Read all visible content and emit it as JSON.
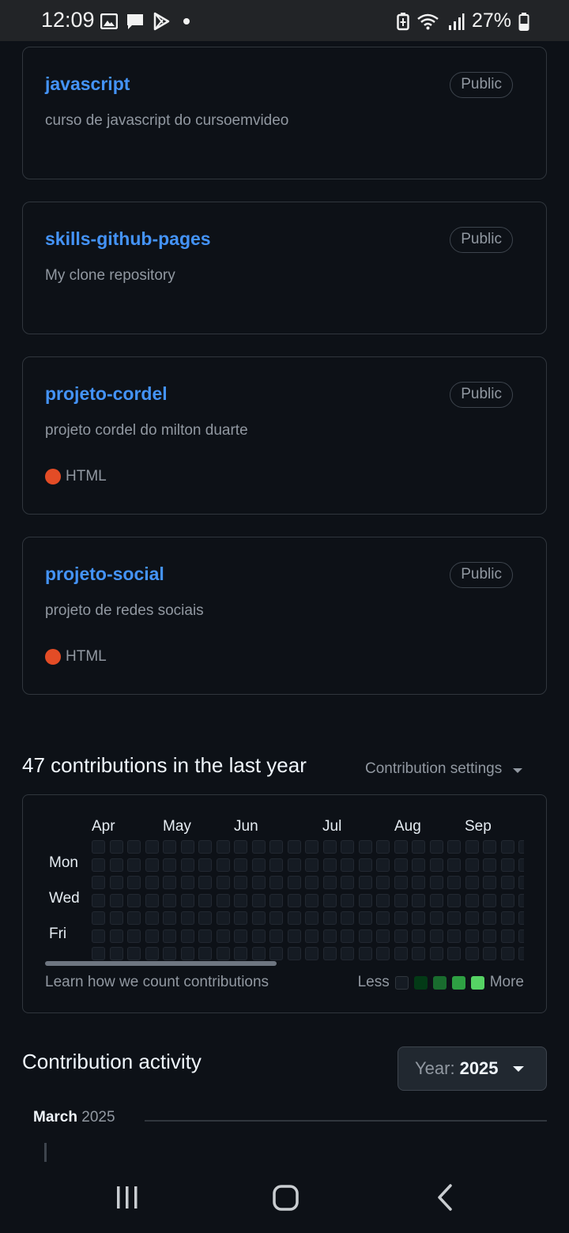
{
  "status_bar": {
    "time": "12:09",
    "battery": "27%",
    "left_icons": [
      "image-icon",
      "message-icon",
      "play-store-icon",
      "dot-icon"
    ],
    "right_icons": [
      "battery-saver-icon",
      "wifi-icon",
      "signal-icon",
      "battery-icon"
    ]
  },
  "repos": [
    {
      "name": "javascript",
      "description": "curso de javascript do cursoemvideo",
      "visibility": "Public",
      "language": ""
    },
    {
      "name": "skills-github-pages",
      "description": "My clone repository",
      "visibility": "Public",
      "language": ""
    },
    {
      "name": "projeto-cordel",
      "description": "projeto cordel do milton duarte",
      "visibility": "Public",
      "language": "HTML"
    },
    {
      "name": "projeto-social",
      "description": "projeto de redes sociais",
      "visibility": "Public",
      "language": "HTML"
    }
  ],
  "colors": {
    "html_language": "#e34c26",
    "link": "#4493f8",
    "legend_levels": [
      "#151b23",
      "#033a16",
      "#196c2e",
      "#2ea043",
      "#56d364"
    ]
  },
  "contributions": {
    "title": "47 contributions in the last year",
    "settings_label": "Contribution settings",
    "months": [
      "Apr",
      "May",
      "Jun",
      "Jul",
      "Aug",
      "Sep"
    ],
    "days": [
      "Mon",
      "Wed",
      "Fri"
    ],
    "learn_link": "Learn how we count contributions",
    "legend_less": "Less",
    "legend_more": "More"
  },
  "activity": {
    "title": "Contribution activity",
    "year_label": "Year:",
    "year_value": "2025",
    "month": "March",
    "month_year": "2025"
  },
  "nav_bar": {
    "icons": [
      "recent-apps-icon",
      "home-icon",
      "back-icon"
    ]
  }
}
